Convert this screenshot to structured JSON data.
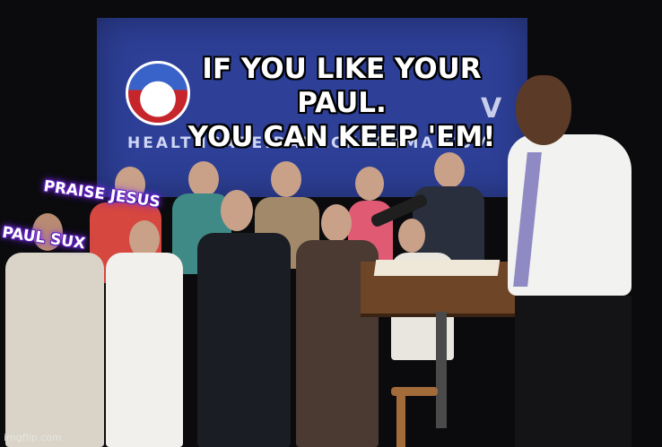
{
  "image": {
    "description_icon": "meme-photo",
    "caption_line1": "IF YOU LIKE YOUR PAUL.",
    "caption_line2": "YOU CAN KEEP 'EM!",
    "tag_top": "PRAISE JESUS",
    "tag_bottom": "PAUL SUX",
    "banner_url": "HEALTHCARE.BARACKOBAMA.COM",
    "banner_letter": "V",
    "watermark": "imgflip.com"
  },
  "colors": {
    "banner": "#2d3f96",
    "tag_glow": "#7b2ff0",
    "caption_text": "#ffffff",
    "podium": "#6e4526"
  }
}
